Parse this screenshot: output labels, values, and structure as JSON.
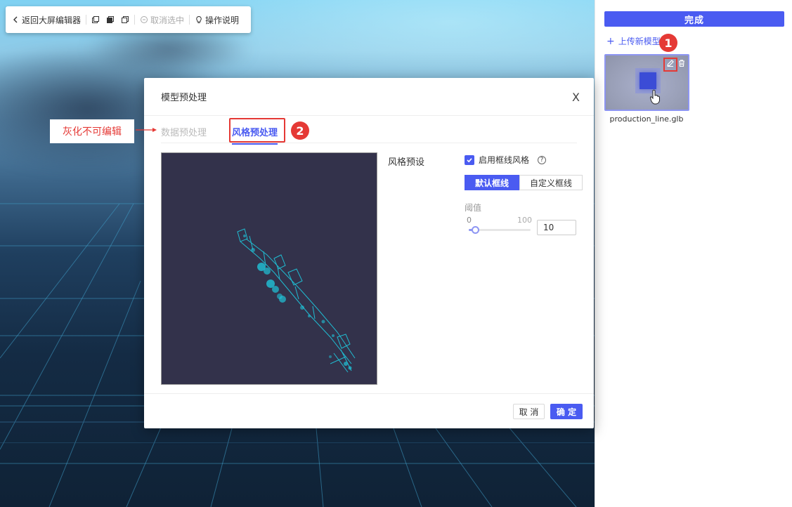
{
  "toolbar": {
    "back_label": "返回大屏编辑器",
    "deselect_label": "取消选中",
    "help_label": "操作说明"
  },
  "right_panel": {
    "done_label": "完成",
    "upload_label": "上传新模型",
    "model_name": "production_line.glb"
  },
  "modal": {
    "title": "模型预处理",
    "close_glyph": "X",
    "tabs": [
      {
        "label": "数据预处理",
        "state": "disabled"
      },
      {
        "label": "风格预处理",
        "state": "active"
      }
    ],
    "style_preset_label": "风格预设",
    "wireframe_checkbox_label": "启用框线风格",
    "wireframe_checked": true,
    "help_glyph": "?",
    "wire_modes": [
      {
        "label": "默认框线",
        "active": true
      },
      {
        "label": "自定义框线",
        "active": false
      }
    ],
    "threshold_label": "阈值",
    "range_min": "0",
    "range_max": "100",
    "threshold_value": "10",
    "cancel_label": "取 消",
    "ok_label": "确 定"
  },
  "annotations": {
    "badge_1": "1",
    "badge_2": "2",
    "note": "灰化不可编辑"
  },
  "colors": {
    "primary": "#4a5bf1",
    "annotation_red": "#e53935",
    "preview_bg": "#33324b",
    "wireframe": "#1fc3d8"
  }
}
